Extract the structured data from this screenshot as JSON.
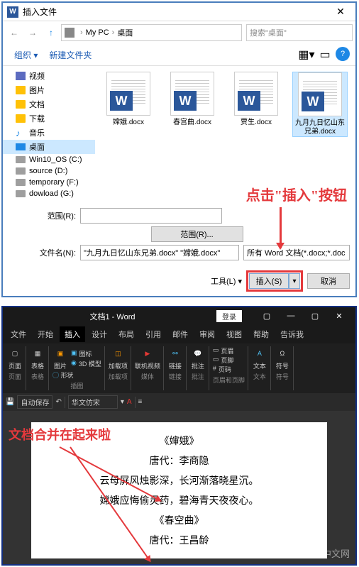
{
  "dialog": {
    "title": "插入文件",
    "breadcrumb": {
      "pc": "My PC",
      "folder": "桌面"
    },
    "search_placeholder": "搜索\"桌面\"",
    "organize": "组织",
    "new_folder": "新建文件夹",
    "sidebar": [
      {
        "label": "视频",
        "icon": "video"
      },
      {
        "label": "图片",
        "icon": "folder"
      },
      {
        "label": "文档",
        "icon": "folder"
      },
      {
        "label": "下载",
        "icon": "folder"
      },
      {
        "label": "音乐",
        "icon": "music"
      },
      {
        "label": "桌面",
        "icon": "desktop",
        "selected": true
      },
      {
        "label": "Win10_OS (C:)",
        "icon": "disk"
      },
      {
        "label": "source (D:)",
        "icon": "disk"
      },
      {
        "label": "temporary (F:)",
        "icon": "disk"
      },
      {
        "label": "dowload (G:)",
        "icon": "disk"
      }
    ],
    "files": [
      {
        "name": "嫦娥.docx"
      },
      {
        "name": "春宫曲.docx"
      },
      {
        "name": "贾生.docx"
      },
      {
        "name": "九月九日忆山东兄弟.docx",
        "selected": true
      }
    ],
    "range_label": "范围(R):",
    "range_button": "范围(R)...",
    "filename_label": "文件名(N):",
    "filename_value": "\"九月九日忆山东兄弟.docx\" \"嫦娥.docx\"",
    "filetype_value": "所有 Word 文档(*.docx;*.doc",
    "tools_label": "工具(L)",
    "insert_button": "插入(S)",
    "cancel_button": "取消",
    "annotation": "点击\"插入\"按钮"
  },
  "word": {
    "title": "文档1 - Word",
    "login": "登录",
    "tabs": [
      "文件",
      "开始",
      "插入",
      "设计",
      "布局",
      "引用",
      "邮件",
      "审阅",
      "视图",
      "帮助",
      "告诉我"
    ],
    "active_tab": "插入",
    "groups": {
      "pages": {
        "label": "页面",
        "item": "页面"
      },
      "tables": {
        "label": "表格",
        "item": "表格"
      },
      "illustrations": {
        "label": "插图",
        "pic": "图片",
        "shapes": "形状",
        "icons": "图标",
        "model3d": "3D 模型"
      },
      "addins": {
        "label": "加载项",
        "item": "加载项"
      },
      "media": {
        "label": "媒体",
        "video": "联机视频"
      },
      "links": {
        "label": "链接",
        "item": "链接"
      },
      "comments": {
        "label": "批注",
        "item": "批注"
      },
      "header": {
        "label": "页眉和页脚",
        "h": "页眉",
        "f": "页脚",
        "n": "页码"
      },
      "text": {
        "label": "文本",
        "item": "文本"
      },
      "symbols": {
        "label": "符号",
        "item": "符号"
      }
    },
    "format_bar": {
      "autosave": "自动保存",
      "font": "华文仿宋"
    },
    "document": {
      "title1": "《婶娥》",
      "author1": "唐代：李商隐",
      "line1": "云母屏风烛影深，长河渐落晓星沉。",
      "line2": "嫦娥应悔偷灵药，碧海青天夜夜心。",
      "title2": "《春空曲》",
      "author2": "唐代：王昌龄"
    },
    "merge_annotation": "文档合并在起来啦",
    "watermark": "中文网"
  }
}
